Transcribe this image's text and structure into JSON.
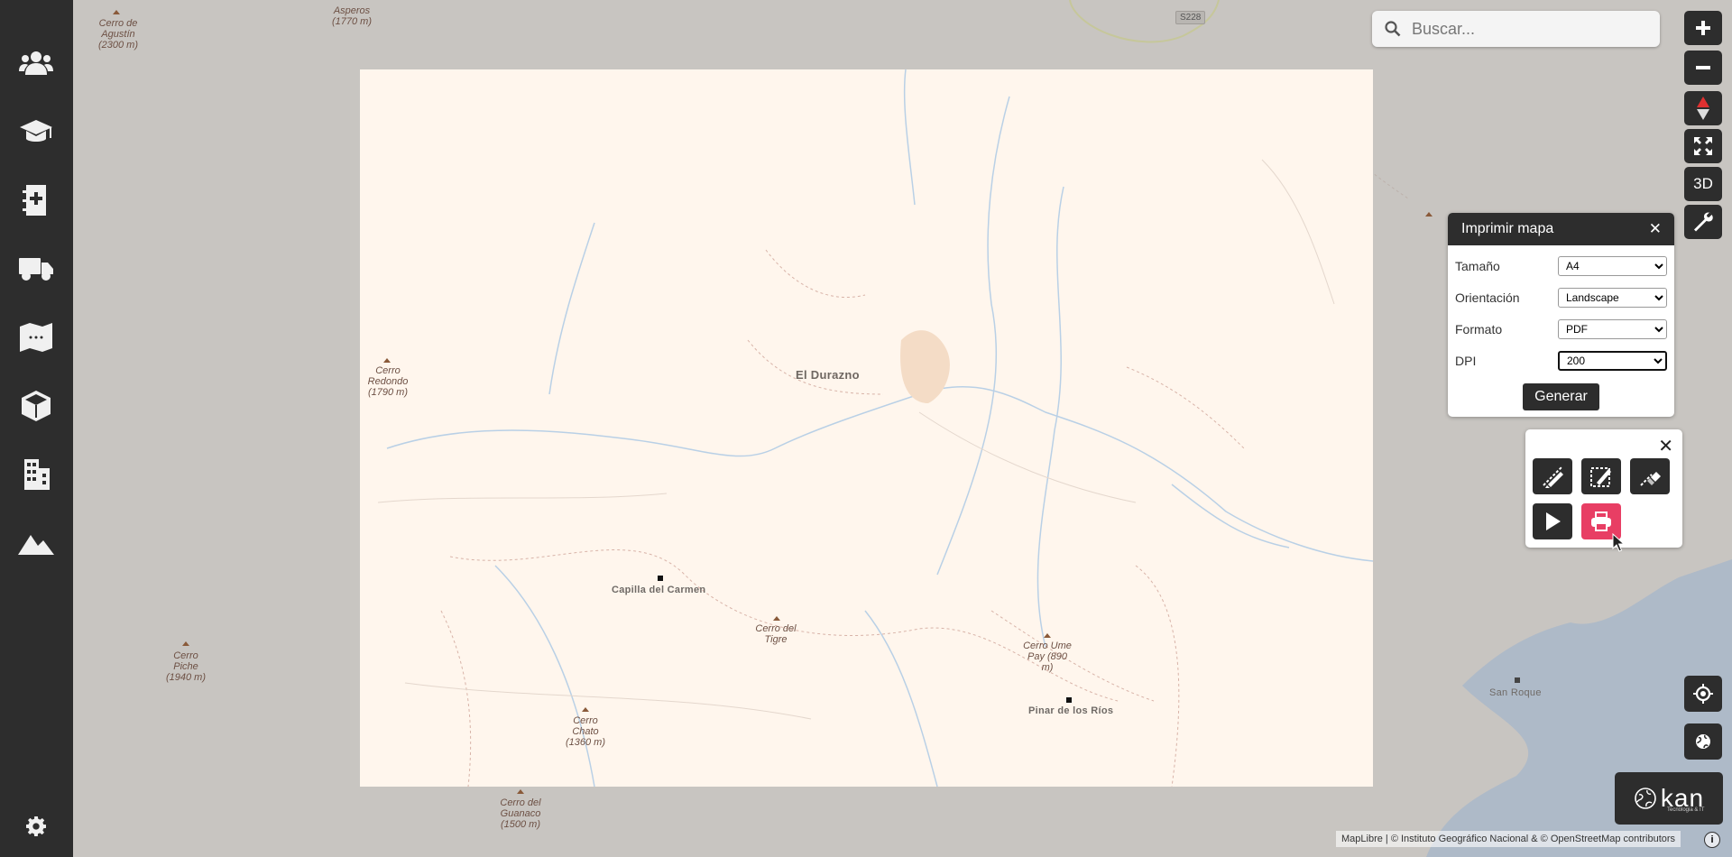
{
  "sidebar": {
    "items": [
      {
        "name": "users-icon"
      },
      {
        "name": "graduation-cap-icon"
      },
      {
        "name": "medical-book-icon"
      },
      {
        "name": "truck-icon"
      },
      {
        "name": "map-icon"
      },
      {
        "name": "box-icon"
      },
      {
        "name": "buildings-icon"
      },
      {
        "name": "mountain-icon"
      },
      {
        "name": "gear-icon"
      }
    ]
  },
  "search": {
    "placeholder": "Buscar..."
  },
  "controls": {
    "three_d_label": "3D"
  },
  "print_panel": {
    "title": "Imprimir mapa",
    "size_label": "Tamaño",
    "size_value": "A4",
    "orientation_label": "Orientación",
    "orientation_value": "Landscape",
    "format_label": "Formato",
    "format_value": "PDF",
    "dpi_label": "DPI",
    "dpi_value": "200",
    "generate_label": "Generar"
  },
  "map": {
    "places": {
      "el_durazno": "El Durazno",
      "capilla": "Capilla del Carmen",
      "pinar": "Pinar de los Ríos",
      "san_roque": "San Roque"
    },
    "peaks": {
      "cerro_agustin": "Cerro de\nAgustín\n(2300 m)",
      "asperos": "Asperos\n(1770 m)",
      "cerro_redondo": "Cerro\nRedondo\n(1790 m)",
      "cerro_piche": "Cerro\nPiche\n(1940 m)",
      "cerro_chato": "Cerro\nChato\n(1360 m)",
      "cerro_guanaco": "Cerro del\nGuanaco\n(1500 m)",
      "cerro_tigre": "Cerro del\nTigre",
      "cerro_ume": "Cerro Ume\nPay  (890\nm)"
    },
    "road_tag": "S228"
  },
  "logo": {
    "text": "kan",
    "sub": "Tecnologia & IT"
  },
  "attribution": "MapLibre | © Instituto Geográfico Nacional & © OpenStreetMap contributors",
  "attribution_info": "i"
}
